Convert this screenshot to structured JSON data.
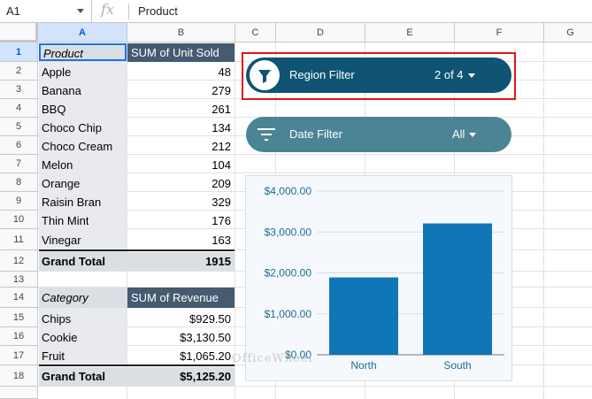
{
  "formula_bar": {
    "cell_ref": "A1",
    "fx": "fx",
    "value": "Product"
  },
  "columns": [
    "A",
    "B",
    "C",
    "D",
    "E",
    "F",
    "G"
  ],
  "rows": [
    "1",
    "2",
    "3",
    "4",
    "5",
    "6",
    "7",
    "8",
    "9",
    "10",
    "11",
    "12",
    "13",
    "14",
    "15",
    "16",
    "17",
    "18"
  ],
  "pivot1": {
    "header": [
      "Product",
      "SUM of Unit Sold"
    ],
    "rows": [
      [
        "Apple",
        "48"
      ],
      [
        "Banana",
        "279"
      ],
      [
        "BBQ",
        "261"
      ],
      [
        "Choco Chip",
        "134"
      ],
      [
        "Choco Cream",
        "212"
      ],
      [
        "Melon",
        "104"
      ],
      [
        "Orange",
        "209"
      ],
      [
        "Raisin Bran",
        "329"
      ],
      [
        "Thin Mint",
        "176"
      ],
      [
        "Vinegar",
        "163"
      ]
    ],
    "total": [
      "Grand Total",
      "1915"
    ]
  },
  "pivot2": {
    "header": [
      "Category",
      "SUM of Revenue"
    ],
    "rows": [
      [
        "Chips",
        "$929.50"
      ],
      [
        "Cookie",
        "$3,130.50"
      ],
      [
        "Fruit",
        "$1,065.20"
      ]
    ],
    "total": [
      "Grand Total",
      "$5,125.20"
    ]
  },
  "slicers": {
    "region": {
      "label": "Region Filter",
      "value": "2 of 4",
      "color": "#0f5472",
      "icon": "filter-circle-icon"
    },
    "date": {
      "label": "Date Filter",
      "value": "All",
      "color": "#4b8494",
      "icon": "filter-lines-icon"
    }
  },
  "chart_data": {
    "type": "bar",
    "categories": [
      "North",
      "South"
    ],
    "values": [
      1890,
      3210
    ],
    "ylim": [
      0,
      4000
    ],
    "yticks": [
      "$0.00",
      "$1,000.00",
      "$2,000.00",
      "$3,000.00",
      "$4,000.00"
    ],
    "title": "",
    "xlabel": "",
    "ylabel": "",
    "bar_color": "#0f77b5",
    "grid": true
  },
  "watermark": "OfficeWheel"
}
